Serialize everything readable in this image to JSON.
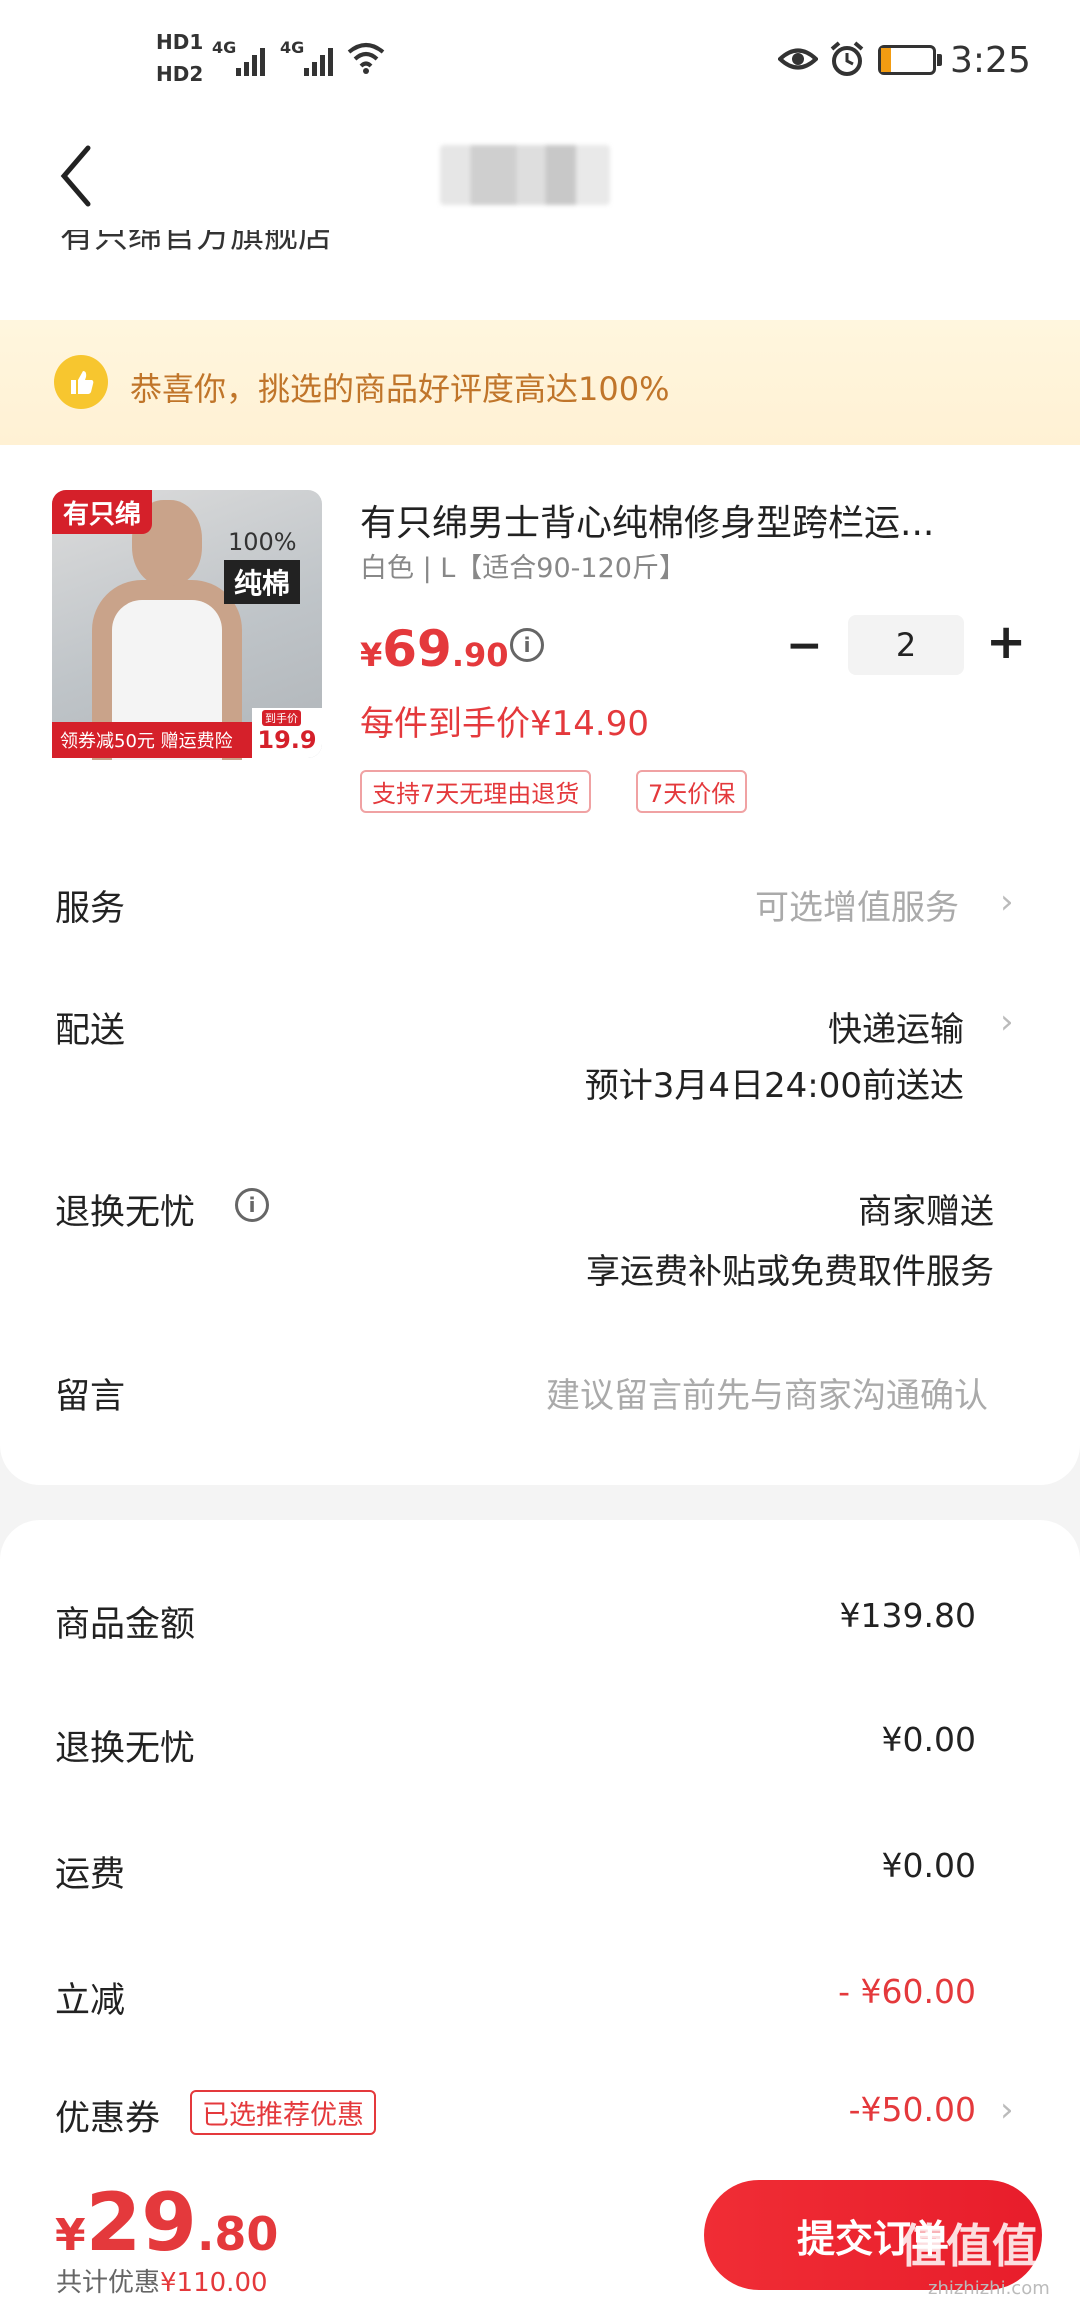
{
  "status_bar": {
    "sim1": "HD1",
    "sim2": "HD2",
    "network1": "4G",
    "network2": "4G",
    "time": "3:25",
    "battery_level": 0.2,
    "icons": [
      "eye-icon",
      "alarm-icon",
      "battery-icon",
      "wifi-icon",
      "signal-icon"
    ]
  },
  "header": {
    "back_icon": "chevron-left-icon"
  },
  "store": {
    "name_partial": "有只绵官方旗舰店"
  },
  "banner": {
    "text": "恭喜你，挑选的商品好评度高达100%",
    "icon": "thumbs-up-icon"
  },
  "product": {
    "image": {
      "brand": "有只绵",
      "percent": "100%",
      "material": "纯棉",
      "coupon": "领券减50元 赠运费险",
      "final_price_label": "到手价",
      "final_price": "19.9"
    },
    "title": "有只绵男士背心纯棉修身型跨栏运...",
    "spec": "白色 | L【适合90-120斤】",
    "price_symbol": "¥",
    "price_int": "69",
    "price_dec": ".90",
    "quantity": "2",
    "unit_price_text": "每件到手价¥14.90",
    "tags": [
      "支持7天无理由退货",
      "7天价保"
    ]
  },
  "rows": {
    "service_label": "服务",
    "service_value": "可选增值服务",
    "delivery_label": "配送",
    "delivery_value": "快递运输",
    "delivery_eta": "预计3月4日24:00前送达",
    "return_label": "退换无忧",
    "return_value": "商家赠送",
    "return_desc": "享运费补贴或免费取件服务",
    "message_label": "留言",
    "message_placeholder": "建议留言前先与商家沟通确认"
  },
  "summary": {
    "goods_label": "商品金额",
    "goods_value": "¥139.80",
    "return_label": "退换无忧",
    "return_value": "¥0.00",
    "shipping_label": "运费",
    "shipping_value": "¥0.00",
    "discount_label": "立减",
    "discount_value": "- ¥60.00",
    "coupon_label": "优惠券",
    "coupon_tag": "已选推荐优惠",
    "coupon_value": "-¥50.00"
  },
  "footer": {
    "total_symbol": "¥",
    "total_int": "29",
    "total_dec": ".80",
    "saving_prefix": "共计优惠",
    "saving_value": "¥110.00",
    "submit_label": "提交订单",
    "watermark": "值值值",
    "watermark_sub": "zhizhizhi.com"
  },
  "colors": {
    "accent_red": "#e4393c",
    "banner_bg": "#fff6de",
    "banner_text": "#c0752a"
  }
}
